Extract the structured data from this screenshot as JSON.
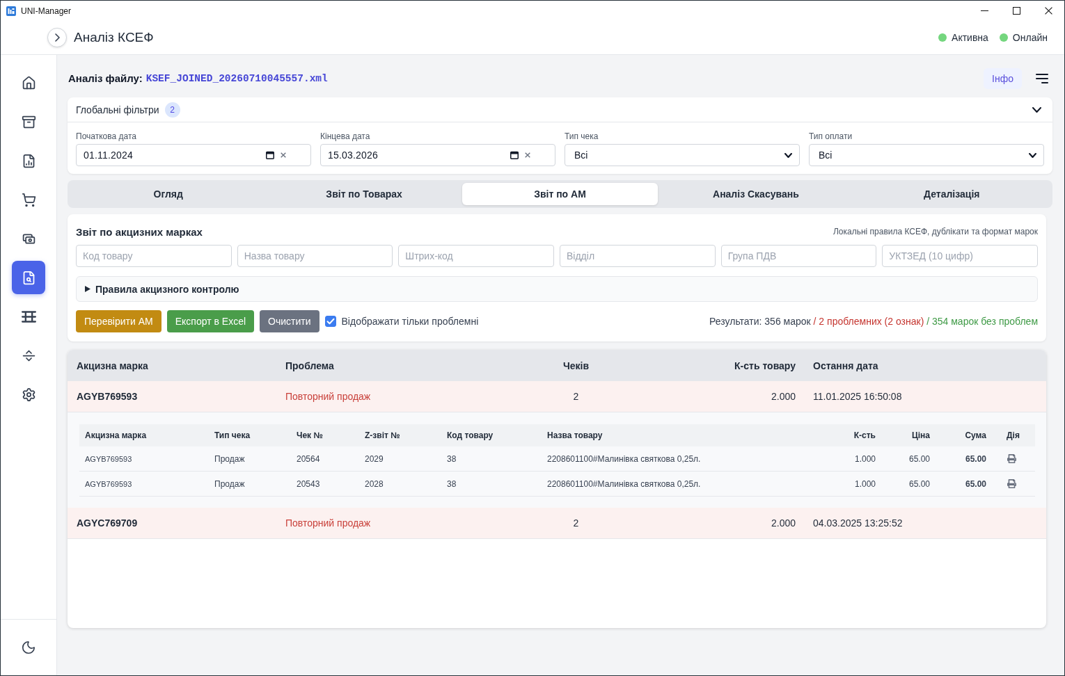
{
  "window": {
    "title": "UNI-Manager"
  },
  "header": {
    "title": "Аналіз КСЕФ",
    "statuses": [
      {
        "label": "Активна",
        "color": "#74d67e"
      },
      {
        "label": "Онлайн",
        "color": "#74d67e"
      }
    ]
  },
  "sidebar": {
    "items": [
      {
        "selected": false
      },
      {
        "selected": false
      },
      {
        "selected": false
      },
      {
        "selected": false
      },
      {
        "selected": false
      },
      {
        "selected": true
      },
      {
        "selected": false
      },
      {
        "selected": false
      },
      {
        "selected": false
      }
    ]
  },
  "file": {
    "label": "Аналіз файлу:",
    "name": "KSEF_JOINED_20260710045557.xml",
    "info_button": "Інфо"
  },
  "global_filters": {
    "title": "Глобальні фільтри",
    "count": "2",
    "expanded": true,
    "fields": [
      {
        "kind": "date",
        "label": "Початкова дата",
        "value": "01.11.2024"
      },
      {
        "kind": "date",
        "label": "Кінцева дата",
        "value": "15.03.2026"
      },
      {
        "kind": "select",
        "label": "Тип чека",
        "value": "Всі"
      },
      {
        "kind": "select",
        "label": "Тип оплати",
        "value": "Всі"
      }
    ]
  },
  "tabs": [
    {
      "label": "Огляд",
      "selected": false
    },
    {
      "label": "Звіт по Товарах",
      "selected": false
    },
    {
      "label": "Звіт по АМ",
      "selected": true
    },
    {
      "label": "Аналіз Скасувань",
      "selected": false
    },
    {
      "label": "Деталізація",
      "selected": false
    }
  ],
  "report": {
    "title": "Звіт по акцизних марках",
    "subtitle": "Локальні правила КСЕФ, дублікати та формат марок",
    "filters": [
      {
        "placeholder": "Код товару"
      },
      {
        "placeholder": "Назва товару"
      },
      {
        "placeholder": "Штрих-код"
      },
      {
        "placeholder": "Відділ"
      },
      {
        "placeholder": "Група ПДВ"
      },
      {
        "placeholder": "УКТЗЕД (10 цифр)"
      }
    ],
    "rules": {
      "label": "Правила акцизного контролю",
      "expanded": false
    },
    "buttons": [
      {
        "kind": "check",
        "label": "Перевірити АМ"
      },
      {
        "kind": "export",
        "label": "Експорт в Excel"
      },
      {
        "kind": "clear",
        "label": "Очистити"
      }
    ],
    "only_problems": {
      "label": "Відображати тільки проблемні",
      "checked": true
    },
    "results": {
      "total": "Результати: 356 марок",
      "problems": "/ 2 проблемних (2 ознак)",
      "clean": "/ 354 марок без проблем"
    }
  },
  "table": {
    "columns": [
      "Акцизна марка",
      "Проблема",
      "Чеків",
      "К-сть товару",
      "Остання дата"
    ],
    "rows": [
      {
        "mark": "AGYB769593",
        "problem": "Повторний продаж",
        "checks": "2",
        "quantity": "2.000",
        "last_date": "11.01.2025 16:50:08",
        "details": {
          "columns": [
            "Акцизна марка",
            "Тип чека",
            "Чек №",
            "Z-звіт №",
            "Код товару",
            "Назва товару",
            "К-сть",
            "Ціна",
            "Сума",
            "Дія"
          ],
          "rows": [
            {
              "cells": [
                "AGYB769593",
                "Продаж",
                "20564",
                "2029",
                "38",
                "2208601100#Малинівка святкова 0,25л.",
                "1.000",
                "65.00",
                "65.00"
              ]
            },
            {
              "cells": [
                "AGYB769593",
                "Продаж",
                "20543",
                "2028",
                "38",
                "2208601100#Малинівка святкова 0,25л.",
                "1.000",
                "65.00",
                "65.00"
              ]
            }
          ]
        }
      },
      {
        "mark": "AGYC769709",
        "problem": "Повторний продаж",
        "checks": "2",
        "quantity": "2.000",
        "last_date": "04.03.2025 13:25:52"
      }
    ]
  }
}
